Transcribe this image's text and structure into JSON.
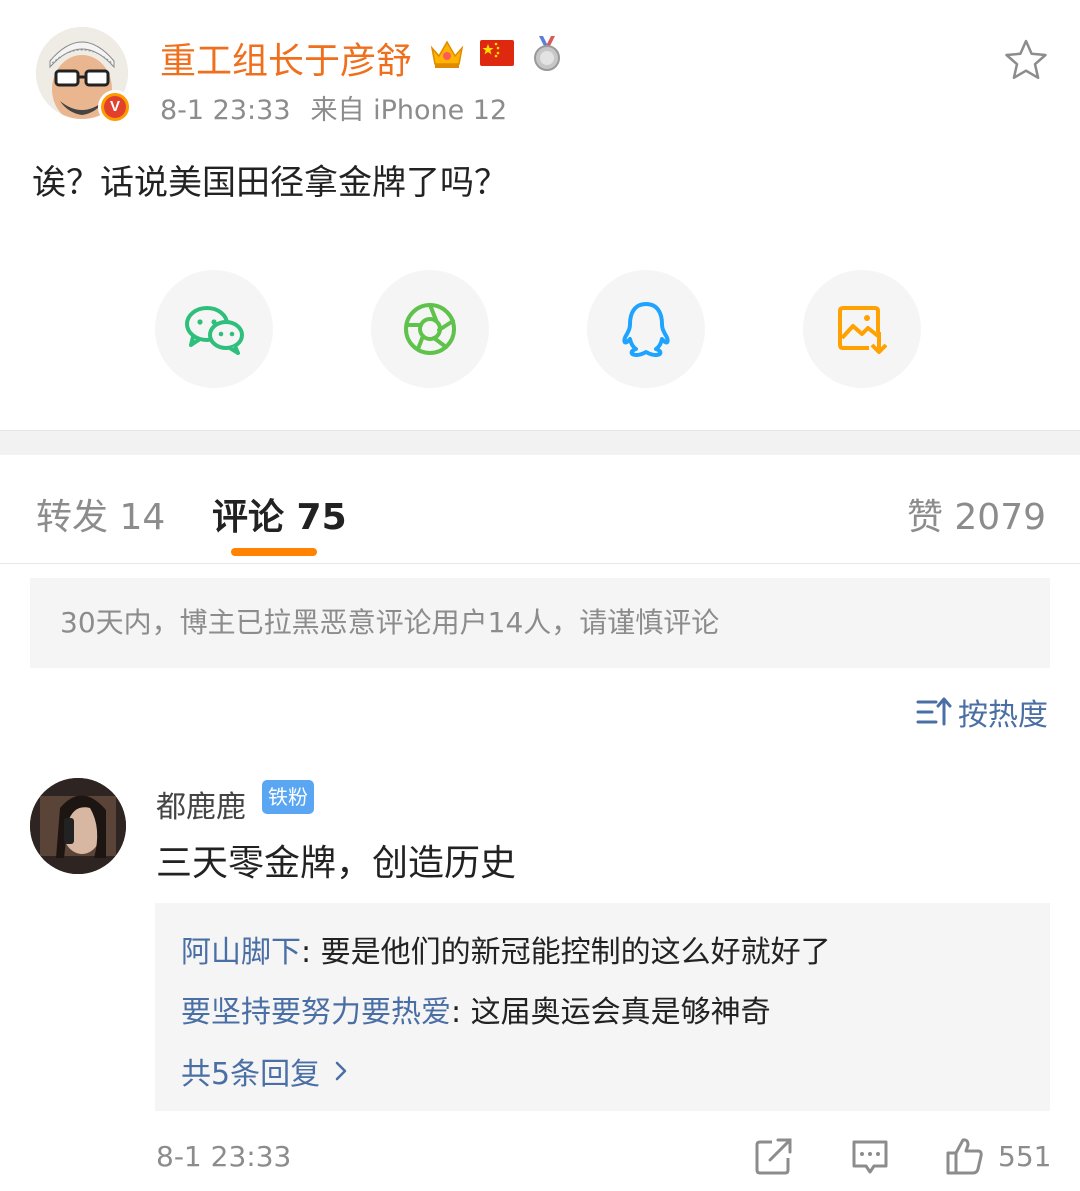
{
  "post": {
    "author": "重工组长于彦舒",
    "time": "8-1 23:33",
    "source": "来自 iPhone 12",
    "text": "诶？话说美国田径拿金牌了吗？",
    "badges": [
      "crown-badge-icon",
      "china-flag-icon",
      "silver-medal-icon"
    ]
  },
  "share": [
    "wechat-icon",
    "moments-icon",
    "qq-icon",
    "save-image-icon"
  ],
  "tabs": {
    "reposts": "转发 14",
    "comments": "评论 75",
    "likes": "赞 2079"
  },
  "notice": "30天内，博主已拉黑恶意评论用户14人，请谨慎评论",
  "sort_label": "按热度",
  "comment": {
    "user": "都鹿鹿",
    "fan_badge": "铁粉",
    "text": "三天零金牌，创造历史",
    "replies": [
      {
        "user": "阿山脚下",
        "text": ": 要是他们的新冠能控制的这么好就好了"
      },
      {
        "user": "要坚持要努力要热爱",
        "text": ": 这届奥运会真是够神奇"
      }
    ],
    "more_replies": "共5条回复",
    "time": "8-1 23:33",
    "like_count": "551"
  },
  "colors": {
    "author": "#f06f1c",
    "accent": "#ff8200",
    "link": "#4a6fa5",
    "muted": "#8c8c8c"
  }
}
